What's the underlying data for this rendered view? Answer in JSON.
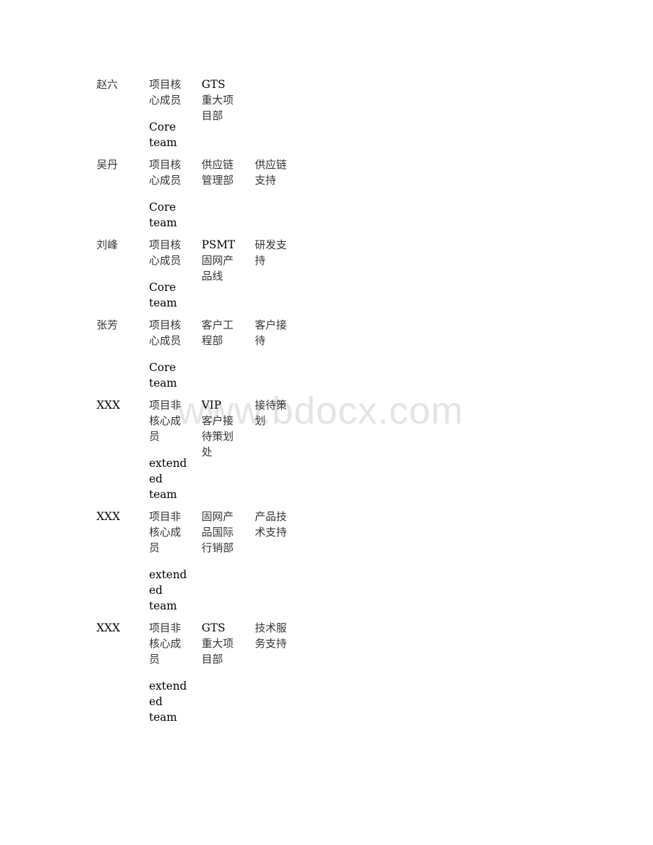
{
  "watermark": "www.bdocx.com",
  "rows": [
    {
      "name": "赵六",
      "role_cn": [
        "项目核",
        "心成员"
      ],
      "role_en": [
        "Core",
        "team"
      ],
      "dept": [
        "GTS",
        "重大项",
        "目部"
      ],
      "duty": []
    },
    {
      "name": "吴丹",
      "role_cn": [
        "项目核",
        "心成员"
      ],
      "role_en": [
        "Core",
        "team"
      ],
      "dept": [
        "供应链",
        "管理部"
      ],
      "duty": [
        "供应链",
        "支持"
      ]
    },
    {
      "name": "刘峰",
      "role_cn": [
        "项目核",
        "心成员"
      ],
      "role_en": [
        "Core",
        "team"
      ],
      "dept": [
        "PSMT",
        "固网产",
        "品线"
      ],
      "duty": [
        "研发支",
        "持"
      ]
    },
    {
      "name": "张芳",
      "role_cn": [
        "项目核",
        "心成员"
      ],
      "role_en": [
        "Core",
        "team"
      ],
      "dept": [
        "客户工",
        "程部"
      ],
      "duty": [
        "客户接",
        "待"
      ]
    },
    {
      "name": "XXX",
      "role_cn": [
        "项目非",
        "核心成",
        "员"
      ],
      "role_en": [
        "extend",
        "ed",
        "team"
      ],
      "dept": [
        "VIP",
        "客户接",
        "待策划",
        "处"
      ],
      "duty": [
        "接待策",
        "划"
      ]
    },
    {
      "name": "XXX",
      "role_cn": [
        "项目非",
        "核心成",
        "员"
      ],
      "role_en": [
        "extend",
        "ed",
        "team"
      ],
      "dept": [
        "固网产",
        "品国际",
        "行销部"
      ],
      "duty": [
        "产品技",
        "术支持"
      ]
    },
    {
      "name": "XXX",
      "role_cn": [
        "项目非",
        "核心成",
        "员"
      ],
      "role_en": [
        "extend",
        "ed",
        "team"
      ],
      "dept": [
        "GTS",
        "重大项",
        "目部"
      ],
      "duty": [
        "技术服",
        "务支持"
      ]
    }
  ]
}
